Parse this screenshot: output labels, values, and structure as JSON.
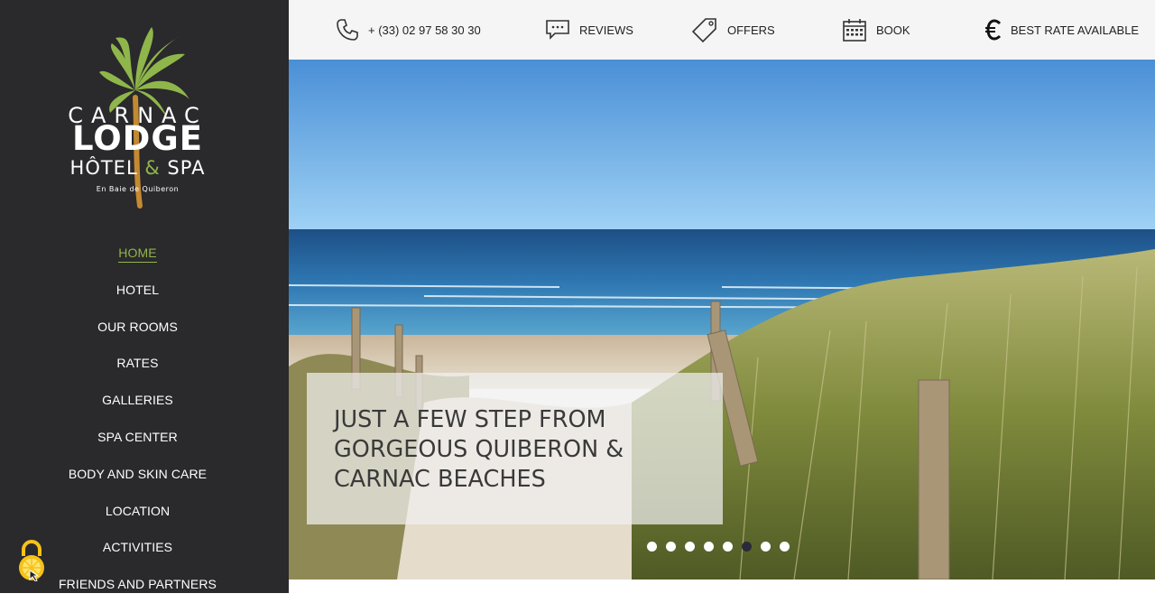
{
  "brand": {
    "line1": "CARNAC",
    "line2": "LODGE",
    "line3a": "HÔTEL",
    "line3amp": "&",
    "line3b": "SPA",
    "tagline": "En Baie de Quiberon"
  },
  "colors": {
    "sidebar_bg": "#2a292c",
    "accent": "#8fb64a",
    "topbar_bg": "#f5f5f5"
  },
  "nav": {
    "items": [
      {
        "label": "HOME",
        "active": true
      },
      {
        "label": "HOTEL"
      },
      {
        "label": "OUR ROOMS"
      },
      {
        "label": "RATES"
      },
      {
        "label": "GALLERIES"
      },
      {
        "label": "SPA CENTER"
      },
      {
        "label": "BODY AND SKIN CARE"
      },
      {
        "label": "LOCATION"
      },
      {
        "label": "ACTIVITIES"
      },
      {
        "label": "FRIENDS AND PARTNERS"
      }
    ]
  },
  "topbar": {
    "phone": {
      "icon": "phone-icon",
      "label": "+ (33) 02 97 58 30 30"
    },
    "reviews": {
      "icon": "chat-bubble-icon",
      "label": "REVIEWS"
    },
    "offers": {
      "icon": "tag-icon",
      "label": "OFFERS"
    },
    "book": {
      "icon": "calendar-icon",
      "label": "BOOK"
    },
    "rate": {
      "icon": "euro-icon",
      "label": "BEST RATE AVAILABLE"
    }
  },
  "hero": {
    "caption": "JUST A FEW STEP FROM GORGEOUS QUIBERON & CARNAC BEACHES",
    "slides": 8,
    "active_slide": 6
  },
  "widget": {
    "icon": "padlock-icon"
  }
}
